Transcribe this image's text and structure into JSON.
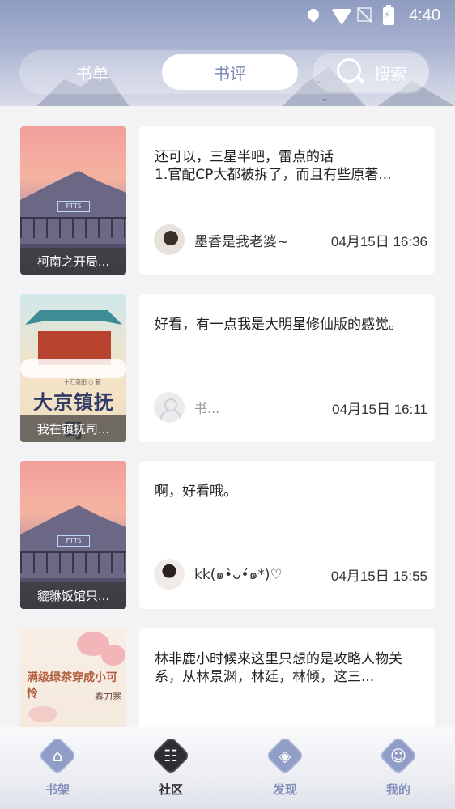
{
  "status_bar": {
    "time": "4:40"
  },
  "top_tabs": {
    "shelf_label": "书单",
    "review_label": "书评",
    "search_label": "搜索"
  },
  "reviews": [
    {
      "book_caption": "柯南之开局...",
      "text": "还可以，三星半吧，雷点的话\n1.官配CP大都被拆了，而且有些原著...",
      "username": "墨香是我老婆~",
      "date": "04月15日 16:36",
      "cover_sign": "FTTS"
    },
    {
      "book_caption": "我在镇抚司...",
      "text": "好看，有一点我是大明星修仙版的感觉。",
      "username": "书...",
      "date": "04月15日 16:11",
      "cover_title": "大京镇抚司"
    },
    {
      "book_caption": "貔貅饭馆只...",
      "text": "啊，好看哦。",
      "username": "kk(๑•̀ᴗ•́๑*)♡",
      "date": "04月15日 15:55",
      "cover_sign": "FTTS"
    },
    {
      "book_caption": "",
      "text": "林非鹿小时候来这里只想的是攻略人物关系，从林景渊，林廷，林倾，这三...",
      "username": "",
      "date": "",
      "cover_title": "满级绿茶穿成小可怜",
      "cover_author": "春刀寒"
    }
  ],
  "bottom_nav": {
    "items": [
      {
        "label": "书架",
        "icon": "house-icon"
      },
      {
        "label": "社区",
        "icon": "chat-icon"
      },
      {
        "label": "发现",
        "icon": "compass-icon"
      },
      {
        "label": "我的",
        "icon": "user-icon"
      }
    ]
  },
  "colors": {
    "accent": "#7a86b3",
    "nav_inactive": "#8390bb",
    "nav_active": "#2d2d33"
  }
}
